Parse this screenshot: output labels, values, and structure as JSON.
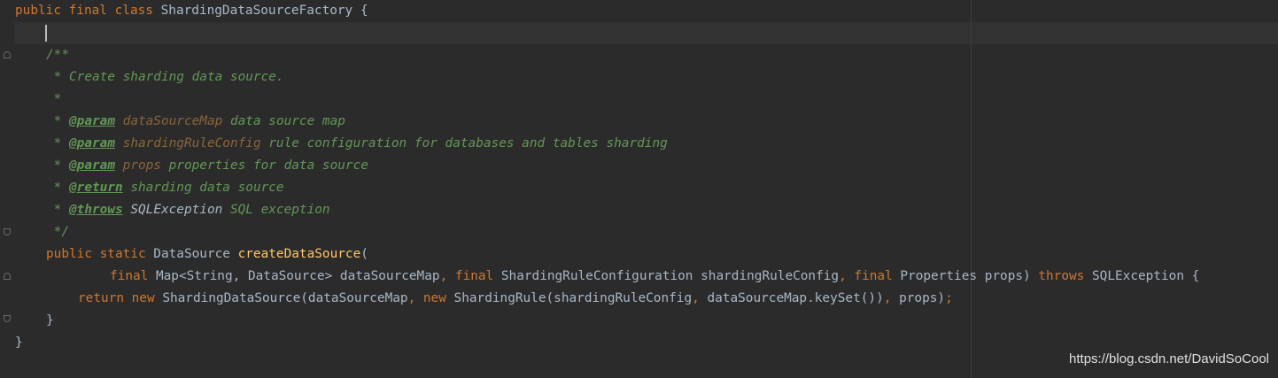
{
  "lines": {
    "l1": [
      {
        "c": "kw",
        "t": "public final class "
      },
      {
        "c": "plain",
        "t": "ShardingDataSourceFactory {"
      }
    ],
    "l2": [],
    "l3": [
      {
        "c": "doc",
        "t": "/**"
      }
    ],
    "l4": [
      {
        "c": "doc",
        "t": " * Create sharding data source."
      }
    ],
    "l5": [
      {
        "c": "doc",
        "t": " *"
      }
    ],
    "l6": [
      {
        "c": "doc",
        "t": " * "
      },
      {
        "c": "tag",
        "t": "@param"
      },
      {
        "c": "doc",
        "t": " "
      },
      {
        "c": "pname",
        "t": "dataSourceMap"
      },
      {
        "c": "dtext",
        "t": " data source map"
      }
    ],
    "l7": [
      {
        "c": "doc",
        "t": " * "
      },
      {
        "c": "tag",
        "t": "@param"
      },
      {
        "c": "doc",
        "t": " "
      },
      {
        "c": "pname",
        "t": "shardingRuleConfig"
      },
      {
        "c": "dtext",
        "t": " rule configuration for databases and tables sharding"
      }
    ],
    "l8": [
      {
        "c": "doc",
        "t": " * "
      },
      {
        "c": "tag",
        "t": "@param"
      },
      {
        "c": "doc",
        "t": " "
      },
      {
        "c": "pname",
        "t": "props"
      },
      {
        "c": "dtext",
        "t": " properties for data source"
      }
    ],
    "l9": [
      {
        "c": "doc",
        "t": " * "
      },
      {
        "c": "tag",
        "t": "@return"
      },
      {
        "c": "dtext",
        "t": " sharding data source"
      }
    ],
    "l10": [
      {
        "c": "doc",
        "t": " * "
      },
      {
        "c": "tag",
        "t": "@throws"
      },
      {
        "c": "doc",
        "t": " "
      },
      {
        "c": "dref",
        "t": "SQLException"
      },
      {
        "c": "dtext",
        "t": " SQL exception"
      }
    ],
    "l11": [
      {
        "c": "doc",
        "t": " */"
      }
    ],
    "l12": [
      {
        "c": "kw",
        "t": "public static "
      },
      {
        "c": "plain",
        "t": "DataSource "
      },
      {
        "c": "fn",
        "t": "createDataSource"
      },
      {
        "c": "plain",
        "t": "("
      }
    ],
    "l13": [
      {
        "c": "kw",
        "t": "final "
      },
      {
        "c": "plain",
        "t": "Map<String, DataSource> dataSourceMap"
      },
      {
        "c": "kw",
        "t": ", final "
      },
      {
        "c": "plain",
        "t": "ShardingRuleConfiguration shardingRuleConfig"
      },
      {
        "c": "kw",
        "t": ", final "
      },
      {
        "c": "plain",
        "t": "Properties props) "
      },
      {
        "c": "kw",
        "t": "throws "
      },
      {
        "c": "plain",
        "t": "SQLException {"
      }
    ],
    "l14": [
      {
        "c": "kw",
        "t": "return new "
      },
      {
        "c": "plain",
        "t": "ShardingDataSource(dataSourceMap"
      },
      {
        "c": "kw",
        "t": ", new "
      },
      {
        "c": "plain",
        "t": "ShardingRule(shardingRuleConfig"
      },
      {
        "c": "kw",
        "t": ", "
      },
      {
        "c": "plain",
        "t": "dataSourceMap.keySet())"
      },
      {
        "c": "kw",
        "t": ", "
      },
      {
        "c": "plain",
        "t": "props)"
      },
      {
        "c": "kw",
        "t": ";"
      }
    ],
    "l15": [
      {
        "c": "plain",
        "t": "}"
      }
    ],
    "l16": [
      {
        "c": "plain",
        "t": "}"
      }
    ]
  },
  "watermark": "https://blog.csdn.net/DavidSoCool"
}
